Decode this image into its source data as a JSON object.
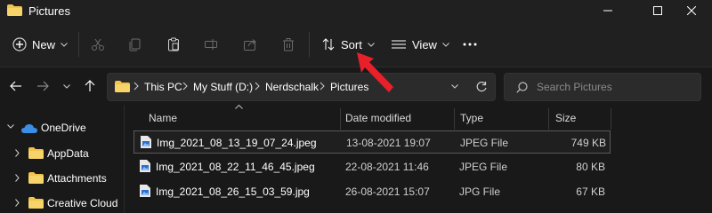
{
  "window": {
    "title": "Pictures"
  },
  "toolbar": {
    "new_label": "New",
    "sort_label": "Sort",
    "view_label": "View"
  },
  "address": {
    "crumbs": [
      "This PC",
      "My Stuff (D:)",
      "Nerdschalk",
      "Pictures"
    ]
  },
  "search": {
    "placeholder": "Search Pictures"
  },
  "sidebar": {
    "items": [
      {
        "label": "OneDrive",
        "icon": "cloud-icon"
      },
      {
        "label": "AppData",
        "icon": "folder-icon"
      },
      {
        "label": "Attachments",
        "icon": "folder-icon"
      },
      {
        "label": "Creative Cloud",
        "icon": "folder-icon"
      }
    ]
  },
  "columns": {
    "name": "Name",
    "date": "Date modified",
    "type": "Type",
    "size": "Size"
  },
  "files": [
    {
      "name": "Img_2021_08_13_19_07_24.jpeg",
      "date": "13-08-2021 19:07",
      "type": "JPEG File",
      "size": "749 KB"
    },
    {
      "name": "Img_2021_08_22_11_46_45.jpeg",
      "date": "22-08-2021 11:46",
      "type": "JPEG File",
      "size": "80 KB"
    },
    {
      "name": "Img_2021_08_26_15_03_59.jpg",
      "date": "26-08-2021 15:07",
      "type": "JPG File",
      "size": "67 KB"
    }
  ],
  "colors": {
    "background": "#191919",
    "bar": "#202020",
    "folder": "#f3c44c",
    "onedrive": "#3a8ee6",
    "annotation_arrow": "#e8202a"
  }
}
